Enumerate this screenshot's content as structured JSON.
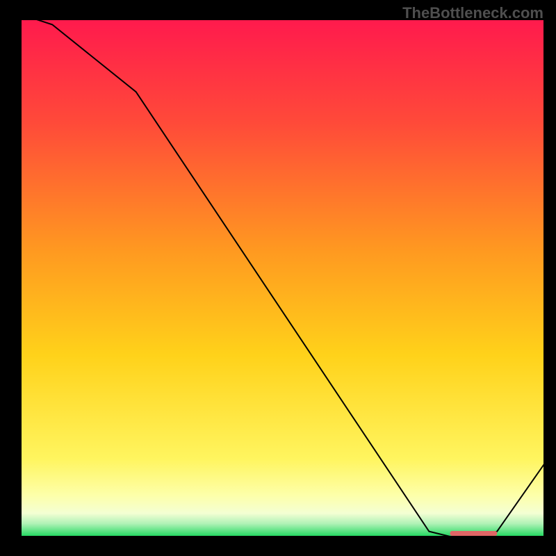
{
  "watermark": "TheBottleneck.com",
  "chart_data": {
    "type": "line",
    "title": "",
    "xlabel": "",
    "ylabel": "",
    "xlim": [
      0,
      100
    ],
    "ylim": [
      0,
      100
    ],
    "x": [
      0,
      6,
      22,
      78,
      82,
      88,
      91,
      100
    ],
    "values": [
      101,
      99,
      86,
      1,
      0,
      0,
      1,
      14
    ],
    "line_color": "#000000",
    "marker": {
      "x_start": 82,
      "x_end": 91,
      "y": 0.6,
      "color": "#e06666"
    },
    "background_gradient": {
      "orientation": "vertical",
      "stops": [
        {
          "pos": 0.0,
          "color": "#ff1a4d"
        },
        {
          "pos": 0.2,
          "color": "#ff4a39"
        },
        {
          "pos": 0.45,
          "color": "#ff9a20"
        },
        {
          "pos": 0.65,
          "color": "#ffd21a"
        },
        {
          "pos": 0.85,
          "color": "#fff55f"
        },
        {
          "pos": 0.92,
          "color": "#fdffa9"
        },
        {
          "pos": 0.955,
          "color": "#f4ffd3"
        },
        {
          "pos": 0.975,
          "color": "#b0f2b6"
        },
        {
          "pos": 1.0,
          "color": "#1fd85f"
        }
      ]
    }
  }
}
